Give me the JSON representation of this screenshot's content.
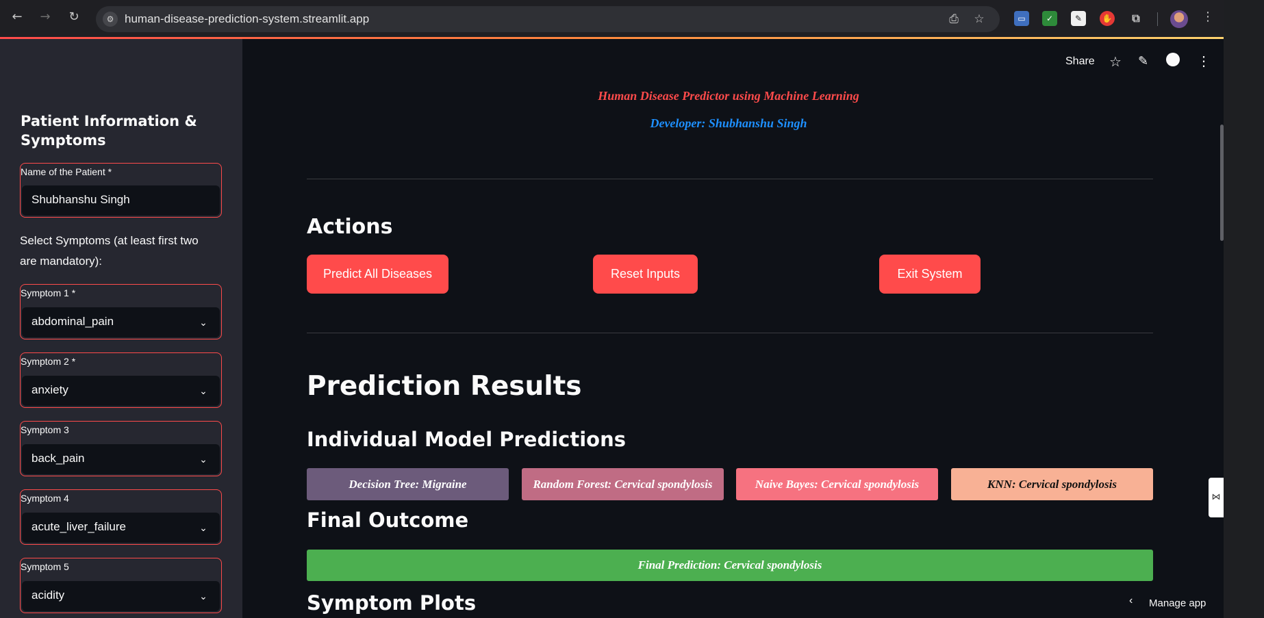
{
  "browser": {
    "url": "human-disease-prediction-system.streamlit.app"
  },
  "toolbar": {
    "share_label": "Share",
    "manage_app_label": "Manage app"
  },
  "header": {
    "title": "Human Disease Predictor using Machine Learning",
    "developer": "Developer: Shubhanshu Singh"
  },
  "sidebar": {
    "title": "Patient Information & Symptoms",
    "name_field": {
      "label": "Name of the Patient *",
      "value": "Shubhanshu Singh"
    },
    "symptoms_note": "Select Symptoms (at least first two are mandatory):",
    "symptoms": [
      {
        "label": "Symptom 1 *",
        "value": "abdominal_pain"
      },
      {
        "label": "Symptom 2 *",
        "value": "anxiety"
      },
      {
        "label": "Symptom 3",
        "value": "back_pain"
      },
      {
        "label": "Symptom 4",
        "value": "acute_liver_failure"
      },
      {
        "label": "Symptom 5",
        "value": "acidity"
      }
    ]
  },
  "actions": {
    "heading": "Actions",
    "predict_label": "Predict All Diseases",
    "reset_label": "Reset Inputs",
    "exit_label": "Exit System"
  },
  "results": {
    "heading": "Prediction Results",
    "individual_heading": "Individual Model Predictions",
    "predictions": [
      {
        "text": "Decision Tree: Migraine",
        "color": "#6c5b7b"
      },
      {
        "text": "Random Forest: Cervical spondylosis",
        "color": "#c06c84"
      },
      {
        "text": "Naive Bayes: Cervical spondylosis",
        "color": "#f67280"
      },
      {
        "text": "KNN: Cervical spondylosis",
        "color": "#f8b195"
      }
    ],
    "final_heading": "Final Outcome",
    "final_prediction": "Final Prediction: Cervical spondylosis",
    "plots_heading": "Symptom Plots"
  },
  "colors": {
    "accent": "#ff4b4b",
    "final_bg": "#4caf50",
    "developer_text": "#1e90ff"
  }
}
